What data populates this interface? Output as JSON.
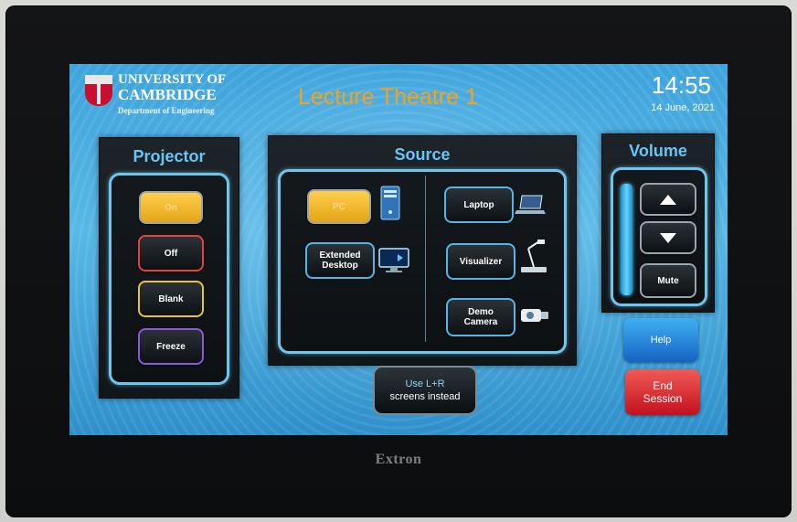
{
  "device": {
    "brand": "Extron"
  },
  "header": {
    "org_line1": "UNIVERSITY OF",
    "org_line2": "CAMBRIDGE",
    "department": "Department of Engineering",
    "room_title": "Lecture Theatre 1",
    "time": "14:55",
    "date": "14 June, 2021"
  },
  "projector": {
    "title": "Projector",
    "buttons": [
      {
        "label": "On",
        "state": "active"
      },
      {
        "label": "Off"
      },
      {
        "label": "Blank"
      },
      {
        "label": "Freeze"
      }
    ]
  },
  "source": {
    "title": "Source",
    "left": [
      {
        "label": "PC",
        "state": "active",
        "icon": "pc-tower-icon"
      },
      {
        "label_line1": "Extended",
        "label_line2": "Desktop",
        "icon": "monitor-icon"
      }
    ],
    "right": [
      {
        "label": "Laptop",
        "icon": "laptop-icon"
      },
      {
        "label": "Visualizer",
        "icon": "visualizer-icon"
      },
      {
        "label_line1": "Demo",
        "label_line2": "Camera",
        "icon": "camera-icon"
      }
    ],
    "alt_button_line1": "Use L+R",
    "alt_button_line2": "screens instead"
  },
  "volume": {
    "title": "Volume",
    "mute_label": "Mute",
    "level": 1.0
  },
  "help_label": "Help",
  "end_session_line1": "End",
  "end_session_line2": "Session",
  "colors": {
    "title_orange": "#f5a21b",
    "panel_title_blue": "#68c6f6",
    "active_yellow": "#e4a516",
    "help_blue": "#1564c3",
    "end_red": "#c3111f"
  }
}
